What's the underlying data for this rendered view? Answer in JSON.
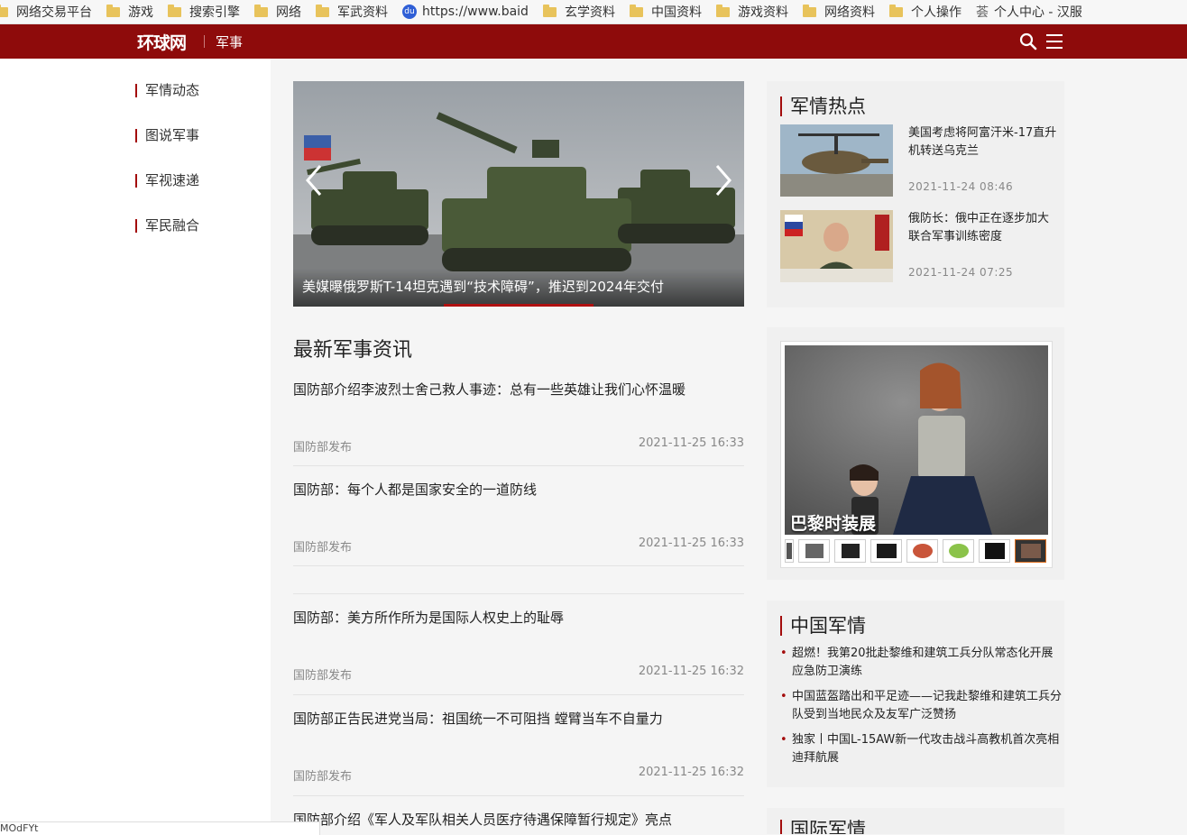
{
  "bookmarks": [
    {
      "label": "网络交易平台",
      "icon": "folder-icon"
    },
    {
      "label": "游戏",
      "icon": "folder-icon"
    },
    {
      "label": "搜索引擎",
      "icon": "folder-icon"
    },
    {
      "label": "网络",
      "icon": "folder-icon"
    },
    {
      "label": "军武资料",
      "icon": "folder-icon"
    },
    {
      "label": "https://www.baid",
      "icon": "baidu-icon"
    },
    {
      "label": "玄学资料",
      "icon": "folder-icon"
    },
    {
      "label": "中国资料",
      "icon": "folder-icon"
    },
    {
      "label": "游戏资料",
      "icon": "folder-icon"
    },
    {
      "label": "网络资料",
      "icon": "folder-icon"
    },
    {
      "label": "个人操作",
      "icon": "folder-icon"
    },
    {
      "label": "个人中心 - 汉服",
      "icon": "page-icon",
      "icon_text": "荟"
    }
  ],
  "header": {
    "logo": "环球网",
    "section": "军事",
    "bg_color": "#8e0b0b"
  },
  "left_nav": [
    "军情动态",
    "图说军事",
    "军视速递",
    "军民融合"
  ],
  "carousel": {
    "caption": "美媒曝俄罗斯T-14坦克遇到“技术障碍”，推迟到2024年交付"
  },
  "main": {
    "title": "最新军事资讯",
    "news": [
      {
        "title": "国防部介绍李波烈士舍己救人事迹：总有一些英雄让我们心怀温暖",
        "source": "国防部发布",
        "time": "2021-11-25 16:33"
      },
      {
        "title": "国防部：每个人都是国家安全的一道防线",
        "source": "国防部发布",
        "time": "2021-11-25 16:33"
      },
      {
        "title": "国防部：美方所作所为是国际人权史上的耻辱",
        "source": "国防部发布",
        "time": "2021-11-25 16:32"
      },
      {
        "title": "国防部正告民进党当局：祖国统一不可阻挡 螳臂当车不自量力",
        "source": "国防部发布",
        "time": "2021-11-25 16:32"
      },
      {
        "title": "国防部介绍《军人及军队相关人员医疗待遇保障暂行规定》亮点",
        "source": "",
        "time": ""
      }
    ]
  },
  "hot": {
    "title": "军情热点",
    "items": [
      {
        "title": "美国考虑将阿富汗米-17直升机转送乌克兰",
        "time": "2021-11-24 08:46"
      },
      {
        "title": "俄防长：俄中正在逐步加大联合军事训练密度",
        "time": "2021-11-24 07:25"
      }
    ]
  },
  "fashion": {
    "caption": "巴黎时装展"
  },
  "china_military": {
    "title": "中国军情",
    "items": [
      "超燃！我第20批赴黎维和建筑工兵分队常态化开展应急防卫演练",
      "中国蓝盔踏出和平足迹——记我赴黎维和建筑工兵分队受到当地民众及友军广泛赞扬",
      "独家丨中国L-15AW新一代攻击战斗高教机首次亮相迪拜航展"
    ]
  },
  "intl_military": {
    "title": "国际军情"
  },
  "status_text": "MOdFYt",
  "accent_color": "#a30c0c"
}
